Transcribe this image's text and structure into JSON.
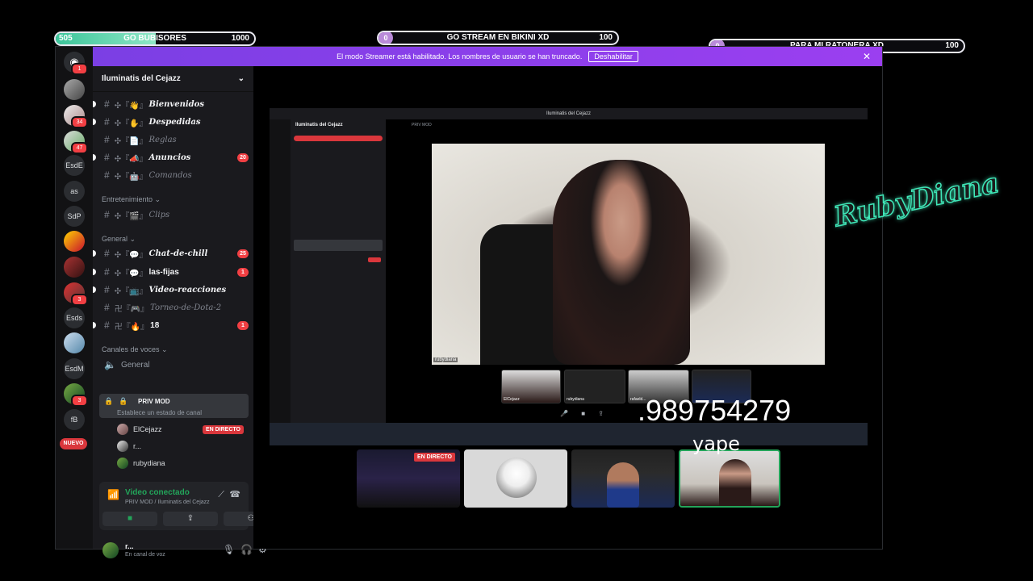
{
  "goals": [
    {
      "current": "505",
      "title": "GO BUBISORES",
      "max": "1000",
      "progress": 0.505
    },
    {
      "current": "0",
      "title": "GO STREAM EN BIKINI XD",
      "max": "100",
      "progress": 0
    },
    {
      "current": "0",
      "title": "PARA MI RATONERA XD",
      "max": "100",
      "progress": 0
    }
  ],
  "banner": {
    "text": "El modo Streamer está habilitado. Los nombres de usuario se han truncado.",
    "button": "Deshabilitar",
    "close": "✕"
  },
  "servers": [
    "EsdE",
    "as",
    "SdP",
    "Esds",
    "EsdM",
    "fB"
  ],
  "server_badges": [
    "1",
    "34",
    "47",
    "3",
    "3"
  ],
  "nuevo": "NUEVO",
  "sidebar": {
    "server_name": "Iluminatis del Cejazz",
    "channels": [
      {
        "name": "Bienvenidos",
        "prefix": "✣『👋』"
      },
      {
        "name": "Despedidas",
        "prefix": "✣『✋』"
      },
      {
        "name": "Reglas",
        "prefix": "✣『📄』"
      },
      {
        "name": "Anuncios",
        "prefix": "✣『📣』",
        "badge": "20"
      },
      {
        "name": "Comandos",
        "prefix": "✣『🤖』"
      }
    ],
    "cat_entretenimiento": "Entretenimiento",
    "clips": {
      "name": "Clips",
      "prefix": "✣『🎬』"
    },
    "cat_general": "General",
    "general_channels": [
      {
        "name": "Chat-de-chill",
        "prefix": "✣『💬』",
        "badge": "25"
      },
      {
        "name": "las-fijas",
        "prefix": "✣『💬』",
        "badge": "1"
      },
      {
        "name": "Video-reacciones",
        "prefix": "✣『📺』"
      },
      {
        "name": "Torneo-de-Dota-2",
        "prefix": "卍『🎮』"
      },
      {
        "name": "18",
        "prefix": "卍『🔥』",
        "badge": "1"
      }
    ],
    "cat_voice": "Canales de voces",
    "voice_general": "General",
    "priv_mod": "PRIV MOD",
    "status_placeholder": "Establece un estado de canal",
    "voice_users": [
      {
        "name": "ElCejazz",
        "live": "EN DIRECTO"
      },
      {
        "name": "r..."
      },
      {
        "name": "rubydiana"
      }
    ],
    "video_connected": "Video conectado",
    "video_sub": "PRIV MOD / Iluminatis del Cejazz",
    "user_name": "r...",
    "user_status": "En canal de voz"
  },
  "inner": {
    "title": "Iluminatis del Cejazz",
    "channel": "PRIV MOD",
    "video_tag": "rubydiana",
    "mini_labels": [
      "ElCejazz",
      "rubydiana",
      "rafaeld...",
      ""
    ]
  },
  "tiles": {
    "live": "EN DIRECTO"
  },
  "overlay": {
    "phone": ".989754279",
    "yape": "yape",
    "signature": "RubyDiana"
  }
}
